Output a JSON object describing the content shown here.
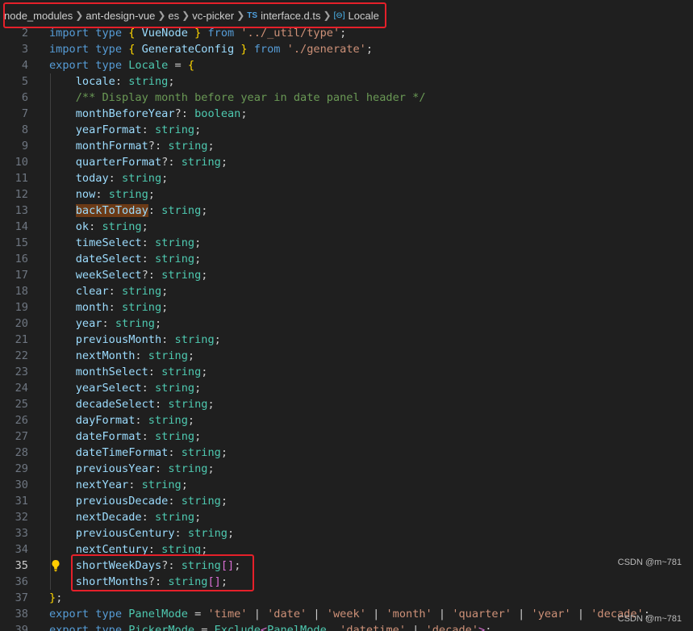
{
  "breadcrumb": {
    "items": [
      "node_modules",
      "ant-design-vue",
      "es",
      "vc-picker",
      "interface.d.ts",
      "Locale"
    ],
    "file_icon": "TS",
    "symbol_icon": "[⊖]"
  },
  "code_lines": [
    {
      "n": "2",
      "tokens": [
        [
          "k",
          "import "
        ],
        [
          "k",
          "type "
        ],
        [
          "b",
          "{ "
        ],
        [
          "v",
          "VueNode "
        ],
        [
          "b",
          "} "
        ],
        [
          "k",
          "from "
        ],
        [
          "s",
          "'../_util/type'"
        ],
        [
          "p",
          ";"
        ]
      ]
    },
    {
      "n": "3",
      "tokens": [
        [
          "k",
          "import "
        ],
        [
          "k",
          "type "
        ],
        [
          "b",
          "{ "
        ],
        [
          "v",
          "GenerateConfig "
        ],
        [
          "b",
          "} "
        ],
        [
          "k",
          "from "
        ],
        [
          "s",
          "'./generate'"
        ],
        [
          "p",
          ";"
        ]
      ]
    },
    {
      "n": "4",
      "tokens": [
        [
          "k",
          "export "
        ],
        [
          "k",
          "type "
        ],
        [
          "t",
          "Locale "
        ],
        [
          "p",
          "= "
        ],
        [
          "b",
          "{"
        ]
      ]
    },
    {
      "n": "5",
      "tokens": [
        [
          "p",
          "    "
        ],
        [
          "v",
          "locale"
        ],
        [
          "p",
          ": "
        ],
        [
          "t",
          "string"
        ],
        [
          "p",
          ";"
        ]
      ]
    },
    {
      "n": "6",
      "tokens": [
        [
          "p",
          "    "
        ],
        [
          "c",
          "/** Display month before year in date panel header */"
        ]
      ]
    },
    {
      "n": "7",
      "tokens": [
        [
          "p",
          "    "
        ],
        [
          "v",
          "monthBeforeYear"
        ],
        [
          "p",
          "?: "
        ],
        [
          "t",
          "boolean"
        ],
        [
          "p",
          ";"
        ]
      ]
    },
    {
      "n": "8",
      "tokens": [
        [
          "p",
          "    "
        ],
        [
          "v",
          "yearFormat"
        ],
        [
          "p",
          ": "
        ],
        [
          "t",
          "string"
        ],
        [
          "p",
          ";"
        ]
      ]
    },
    {
      "n": "9",
      "tokens": [
        [
          "p",
          "    "
        ],
        [
          "v",
          "monthFormat"
        ],
        [
          "p",
          "?: "
        ],
        [
          "t",
          "string"
        ],
        [
          "p",
          ";"
        ]
      ]
    },
    {
      "n": "10",
      "tokens": [
        [
          "p",
          "    "
        ],
        [
          "v",
          "quarterFormat"
        ],
        [
          "p",
          "?: "
        ],
        [
          "t",
          "string"
        ],
        [
          "p",
          ";"
        ]
      ]
    },
    {
      "n": "11",
      "tokens": [
        [
          "p",
          "    "
        ],
        [
          "v",
          "today"
        ],
        [
          "p",
          ": "
        ],
        [
          "t",
          "string"
        ],
        [
          "p",
          ";"
        ]
      ]
    },
    {
      "n": "12",
      "tokens": [
        [
          "p",
          "    "
        ],
        [
          "v",
          "now"
        ],
        [
          "p",
          ": "
        ],
        [
          "t",
          "string"
        ],
        [
          "p",
          ";"
        ]
      ]
    },
    {
      "n": "13",
      "tokens": [
        [
          "p",
          "    "
        ],
        [
          "vh",
          "backToToday"
        ],
        [
          "p",
          ": "
        ],
        [
          "t",
          "string"
        ],
        [
          "p",
          ";"
        ]
      ]
    },
    {
      "n": "14",
      "tokens": [
        [
          "p",
          "    "
        ],
        [
          "v",
          "ok"
        ],
        [
          "p",
          ": "
        ],
        [
          "t",
          "string"
        ],
        [
          "p",
          ";"
        ]
      ]
    },
    {
      "n": "15",
      "tokens": [
        [
          "p",
          "    "
        ],
        [
          "v",
          "timeSelect"
        ],
        [
          "p",
          ": "
        ],
        [
          "t",
          "string"
        ],
        [
          "p",
          ";"
        ]
      ]
    },
    {
      "n": "16",
      "tokens": [
        [
          "p",
          "    "
        ],
        [
          "v",
          "dateSelect"
        ],
        [
          "p",
          ": "
        ],
        [
          "t",
          "string"
        ],
        [
          "p",
          ";"
        ]
      ]
    },
    {
      "n": "17",
      "tokens": [
        [
          "p",
          "    "
        ],
        [
          "v",
          "weekSelect"
        ],
        [
          "p",
          "?: "
        ],
        [
          "t",
          "string"
        ],
        [
          "p",
          ";"
        ]
      ]
    },
    {
      "n": "18",
      "tokens": [
        [
          "p",
          "    "
        ],
        [
          "v",
          "clear"
        ],
        [
          "p",
          ": "
        ],
        [
          "t",
          "string"
        ],
        [
          "p",
          ";"
        ]
      ]
    },
    {
      "n": "19",
      "tokens": [
        [
          "p",
          "    "
        ],
        [
          "v",
          "month"
        ],
        [
          "p",
          ": "
        ],
        [
          "t",
          "string"
        ],
        [
          "p",
          ";"
        ]
      ]
    },
    {
      "n": "20",
      "tokens": [
        [
          "p",
          "    "
        ],
        [
          "v",
          "year"
        ],
        [
          "p",
          ": "
        ],
        [
          "t",
          "string"
        ],
        [
          "p",
          ";"
        ]
      ]
    },
    {
      "n": "21",
      "tokens": [
        [
          "p",
          "    "
        ],
        [
          "v",
          "previousMonth"
        ],
        [
          "p",
          ": "
        ],
        [
          "t",
          "string"
        ],
        [
          "p",
          ";"
        ]
      ]
    },
    {
      "n": "22",
      "tokens": [
        [
          "p",
          "    "
        ],
        [
          "v",
          "nextMonth"
        ],
        [
          "p",
          ": "
        ],
        [
          "t",
          "string"
        ],
        [
          "p",
          ";"
        ]
      ]
    },
    {
      "n": "23",
      "tokens": [
        [
          "p",
          "    "
        ],
        [
          "v",
          "monthSelect"
        ],
        [
          "p",
          ": "
        ],
        [
          "t",
          "string"
        ],
        [
          "p",
          ";"
        ]
      ]
    },
    {
      "n": "24",
      "tokens": [
        [
          "p",
          "    "
        ],
        [
          "v",
          "yearSelect"
        ],
        [
          "p",
          ": "
        ],
        [
          "t",
          "string"
        ],
        [
          "p",
          ";"
        ]
      ]
    },
    {
      "n": "25",
      "tokens": [
        [
          "p",
          "    "
        ],
        [
          "v",
          "decadeSelect"
        ],
        [
          "p",
          ": "
        ],
        [
          "t",
          "string"
        ],
        [
          "p",
          ";"
        ]
      ]
    },
    {
      "n": "26",
      "tokens": [
        [
          "p",
          "    "
        ],
        [
          "v",
          "dayFormat"
        ],
        [
          "p",
          ": "
        ],
        [
          "t",
          "string"
        ],
        [
          "p",
          ";"
        ]
      ]
    },
    {
      "n": "27",
      "tokens": [
        [
          "p",
          "    "
        ],
        [
          "v",
          "dateFormat"
        ],
        [
          "p",
          ": "
        ],
        [
          "t",
          "string"
        ],
        [
          "p",
          ";"
        ]
      ]
    },
    {
      "n": "28",
      "tokens": [
        [
          "p",
          "    "
        ],
        [
          "v",
          "dateTimeFormat"
        ],
        [
          "p",
          ": "
        ],
        [
          "t",
          "string"
        ],
        [
          "p",
          ";"
        ]
      ]
    },
    {
      "n": "29",
      "tokens": [
        [
          "p",
          "    "
        ],
        [
          "v",
          "previousYear"
        ],
        [
          "p",
          ": "
        ],
        [
          "t",
          "string"
        ],
        [
          "p",
          ";"
        ]
      ]
    },
    {
      "n": "30",
      "tokens": [
        [
          "p",
          "    "
        ],
        [
          "v",
          "nextYear"
        ],
        [
          "p",
          ": "
        ],
        [
          "t",
          "string"
        ],
        [
          "p",
          ";"
        ]
      ]
    },
    {
      "n": "31",
      "tokens": [
        [
          "p",
          "    "
        ],
        [
          "v",
          "previousDecade"
        ],
        [
          "p",
          ": "
        ],
        [
          "t",
          "string"
        ],
        [
          "p",
          ";"
        ]
      ]
    },
    {
      "n": "32",
      "tokens": [
        [
          "p",
          "    "
        ],
        [
          "v",
          "nextDecade"
        ],
        [
          "p",
          ": "
        ],
        [
          "t",
          "string"
        ],
        [
          "p",
          ";"
        ]
      ]
    },
    {
      "n": "33",
      "tokens": [
        [
          "p",
          "    "
        ],
        [
          "v",
          "previousCentury"
        ],
        [
          "p",
          ": "
        ],
        [
          "t",
          "string"
        ],
        [
          "p",
          ";"
        ]
      ]
    },
    {
      "n": "34",
      "tokens": [
        [
          "p",
          "    "
        ],
        [
          "v",
          "nextCentury"
        ],
        [
          "p",
          ": "
        ],
        [
          "t",
          "string"
        ],
        [
          "p",
          ";"
        ]
      ]
    },
    {
      "n": "35",
      "tokens": [
        [
          "p",
          "    "
        ],
        [
          "v",
          "shortWeekDays"
        ],
        [
          "p",
          "?: "
        ],
        [
          "t",
          "string"
        ],
        [
          "b2",
          "[]"
        ],
        [
          "p",
          ";"
        ]
      ],
      "active": true,
      "bulb": true
    },
    {
      "n": "36",
      "tokens": [
        [
          "p",
          "    "
        ],
        [
          "v",
          "shortMonths"
        ],
        [
          "p",
          "?: "
        ],
        [
          "t",
          "string"
        ],
        [
          "b2",
          "[]"
        ],
        [
          "p",
          ";"
        ]
      ]
    },
    {
      "n": "37",
      "tokens": [
        [
          "b",
          "}"
        ],
        [
          "p",
          ";"
        ]
      ]
    },
    {
      "n": "38",
      "tokens": [
        [
          "k",
          "export "
        ],
        [
          "k",
          "type "
        ],
        [
          "t",
          "PanelMode "
        ],
        [
          "p",
          "= "
        ],
        [
          "s",
          "'time'"
        ],
        [
          "p",
          " | "
        ],
        [
          "s",
          "'date'"
        ],
        [
          "p",
          " | "
        ],
        [
          "s",
          "'week'"
        ],
        [
          "p",
          " | "
        ],
        [
          "s",
          "'month'"
        ],
        [
          "p",
          " | "
        ],
        [
          "s",
          "'quarter'"
        ],
        [
          "p",
          " | "
        ],
        [
          "s",
          "'year'"
        ],
        [
          "p",
          " | "
        ],
        [
          "s",
          "'decade'"
        ],
        [
          "p",
          ";"
        ]
      ]
    },
    {
      "n": "39",
      "tokens": [
        [
          "k",
          "export "
        ],
        [
          "k",
          "type "
        ],
        [
          "t",
          "PickerMode "
        ],
        [
          "p",
          "= "
        ],
        [
          "t",
          "Exclude"
        ],
        [
          "b2",
          "<"
        ],
        [
          "t",
          "PanelMode"
        ],
        [
          "p",
          ", "
        ],
        [
          "s",
          "'datetime'"
        ],
        [
          "p",
          " | "
        ],
        [
          "s",
          "'decade'"
        ],
        [
          "b2",
          ">"
        ],
        [
          "p",
          ";"
        ]
      ]
    }
  ],
  "watermarks": [
    "CSDN @m~781",
    "CSDN @m~781"
  ],
  "colors": {
    "background": "#1f1f1f",
    "keyword": "#569cd6",
    "type": "#4ec9b0",
    "property": "#9cdcfe",
    "string": "#ce9178",
    "comment": "#6a9955",
    "bracket": "#ffd700",
    "highlight_box": "#e5202a"
  }
}
